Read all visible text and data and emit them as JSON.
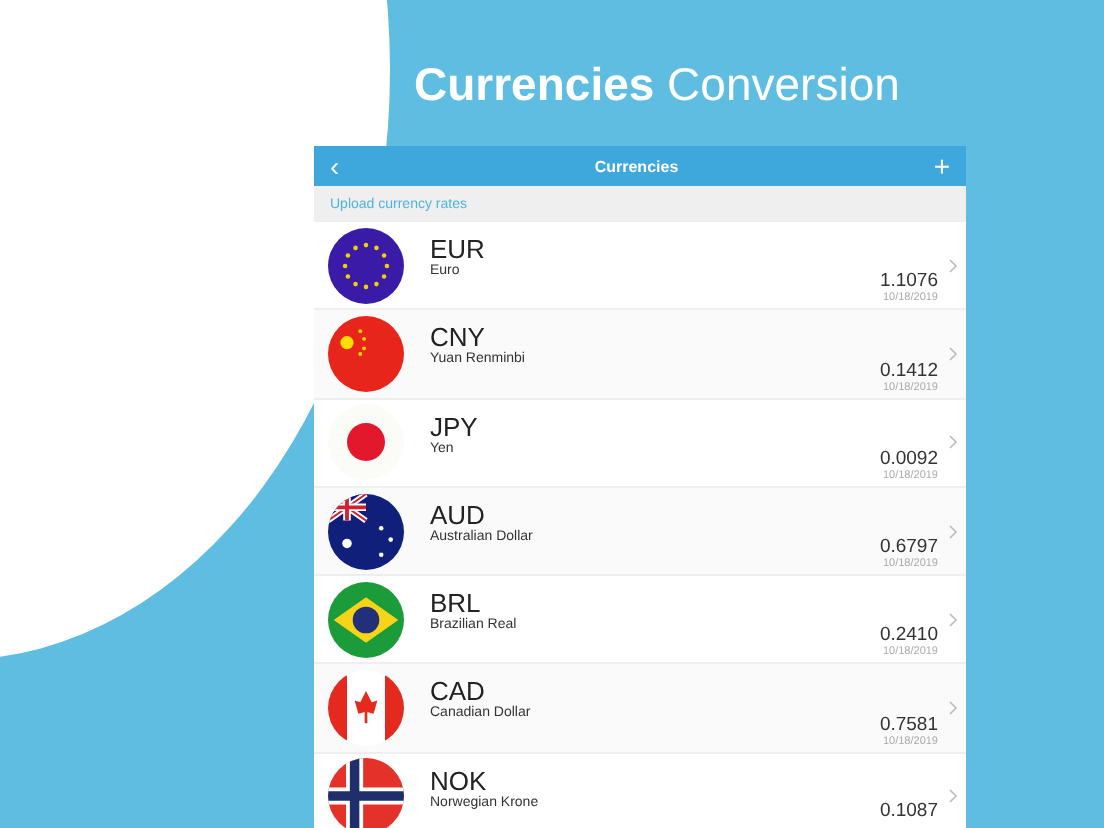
{
  "headline": "**Currencies** Conversion",
  "nav": {
    "back": "‹",
    "title": "Currencies",
    "add": "+"
  },
  "upload_link": "Upload currency rates",
  "currencies": [
    {
      "kind": "eu",
      "code": "EUR",
      "name": "Euro",
      "rate": "1.1076",
      "date": "10/18/2019"
    },
    {
      "kind": "cn",
      "code": "CNY",
      "name": "Yuan Renminbi",
      "rate": "0.1412",
      "date": "10/18/2019"
    },
    {
      "kind": "jp",
      "code": "JPY",
      "name": "Yen",
      "rate": "0.0092",
      "date": "10/18/2019"
    },
    {
      "kind": "au",
      "code": "AUD",
      "name": "Australian Dollar",
      "rate": "0.6797",
      "date": "10/18/2019"
    },
    {
      "kind": "br",
      "code": "BRL",
      "name": "Brazilian Real",
      "rate": "0.2410",
      "date": "10/18/2019"
    },
    {
      "kind": "ca",
      "code": "CAD",
      "name": "Canadian Dollar",
      "rate": "0.7581",
      "date": "10/18/2019"
    },
    {
      "kind": "no",
      "code": "NOK",
      "name": "Norwegian Krone",
      "rate": "0.1087"
    }
  ]
}
